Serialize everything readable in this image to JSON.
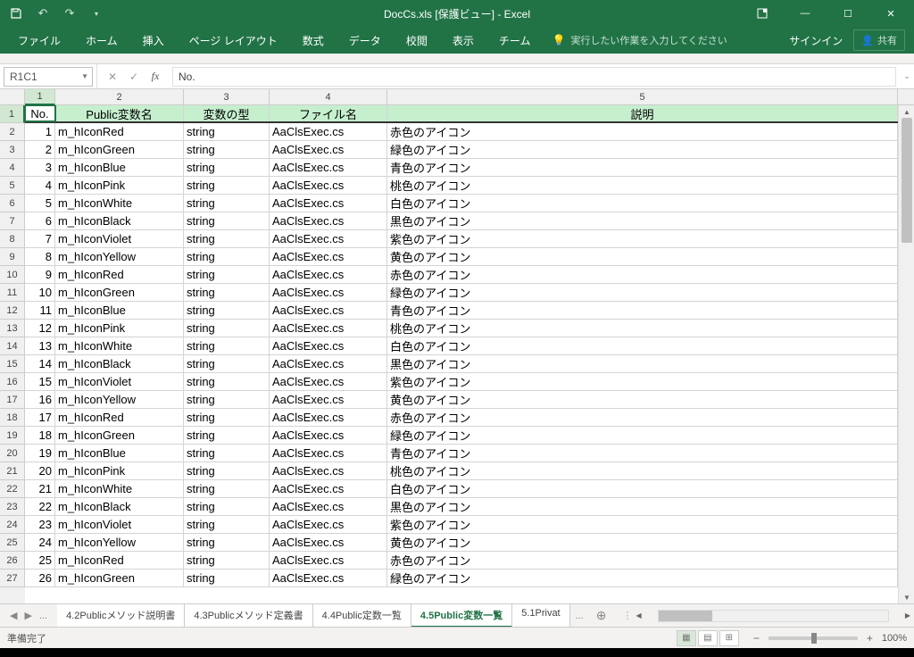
{
  "title": "DocCs.xls  [保護ビュー] - Excel",
  "qat": {
    "save": "save",
    "undo": "undo",
    "redo": "redo"
  },
  "win": {
    "ribbonopts": "⬚",
    "min": "—",
    "max": "☐",
    "close": "✕"
  },
  "tabs": [
    "ファイル",
    "ホーム",
    "挿入",
    "ページ レイアウト",
    "数式",
    "データ",
    "校閲",
    "表示",
    "チーム"
  ],
  "tellme": "実行したい作業を入力してください",
  "signin": "サインイン",
  "share": "共有",
  "nameBox": "R1C1",
  "formula": "No.",
  "colNums": [
    "1",
    "2",
    "3",
    "4",
    "5"
  ],
  "headers": {
    "c1": "No.",
    "c2": "Public変数名",
    "c3": "変数の型",
    "c4": "ファイル名",
    "c5": "説明"
  },
  "rows": [
    {
      "n": "1",
      "v": "m_hIconRed",
      "t": "string",
      "f": "AaClsExec.cs",
      "d": "赤色のアイコン"
    },
    {
      "n": "2",
      "v": "m_hIconGreen",
      "t": "string",
      "f": "AaClsExec.cs",
      "d": "緑色のアイコン"
    },
    {
      "n": "3",
      "v": "m_hIconBlue",
      "t": "string",
      "f": "AaClsExec.cs",
      "d": "青色のアイコン"
    },
    {
      "n": "4",
      "v": "m_hIconPink",
      "t": "string",
      "f": "AaClsExec.cs",
      "d": "桃色のアイコン"
    },
    {
      "n": "5",
      "v": "m_hIconWhite",
      "t": "string",
      "f": "AaClsExec.cs",
      "d": "白色のアイコン"
    },
    {
      "n": "6",
      "v": "m_hIconBlack",
      "t": "string",
      "f": "AaClsExec.cs",
      "d": "黒色のアイコン"
    },
    {
      "n": "7",
      "v": "m_hIconViolet",
      "t": "string",
      "f": "AaClsExec.cs",
      "d": "紫色のアイコン"
    },
    {
      "n": "8",
      "v": "m_hIconYellow",
      "t": "string",
      "f": "AaClsExec.cs",
      "d": "黄色のアイコン"
    },
    {
      "n": "9",
      "v": "m_hIconRed",
      "t": "string",
      "f": "AaClsExec.cs",
      "d": "赤色のアイコン"
    },
    {
      "n": "10",
      "v": "m_hIconGreen",
      "t": "string",
      "f": "AaClsExec.cs",
      "d": "緑色のアイコン"
    },
    {
      "n": "11",
      "v": "m_hIconBlue",
      "t": "string",
      "f": "AaClsExec.cs",
      "d": "青色のアイコン"
    },
    {
      "n": "12",
      "v": "m_hIconPink",
      "t": "string",
      "f": "AaClsExec.cs",
      "d": "桃色のアイコン"
    },
    {
      "n": "13",
      "v": "m_hIconWhite",
      "t": "string",
      "f": "AaClsExec.cs",
      "d": "白色のアイコン"
    },
    {
      "n": "14",
      "v": "m_hIconBlack",
      "t": "string",
      "f": "AaClsExec.cs",
      "d": "黒色のアイコン"
    },
    {
      "n": "15",
      "v": "m_hIconViolet",
      "t": "string",
      "f": "AaClsExec.cs",
      "d": "紫色のアイコン"
    },
    {
      "n": "16",
      "v": "m_hIconYellow",
      "t": "string",
      "f": "AaClsExec.cs",
      "d": "黄色のアイコン"
    },
    {
      "n": "17",
      "v": "m_hIconRed",
      "t": "string",
      "f": "AaClsExec.cs",
      "d": "赤色のアイコン"
    },
    {
      "n": "18",
      "v": "m_hIconGreen",
      "t": "string",
      "f": "AaClsExec.cs",
      "d": "緑色のアイコン"
    },
    {
      "n": "19",
      "v": "m_hIconBlue",
      "t": "string",
      "f": "AaClsExec.cs",
      "d": "青色のアイコン"
    },
    {
      "n": "20",
      "v": "m_hIconPink",
      "t": "string",
      "f": "AaClsExec.cs",
      "d": "桃色のアイコン"
    },
    {
      "n": "21",
      "v": "m_hIconWhite",
      "t": "string",
      "f": "AaClsExec.cs",
      "d": "白色のアイコン"
    },
    {
      "n": "22",
      "v": "m_hIconBlack",
      "t": "string",
      "f": "AaClsExec.cs",
      "d": "黒色のアイコン"
    },
    {
      "n": "23",
      "v": "m_hIconViolet",
      "t": "string",
      "f": "AaClsExec.cs",
      "d": "紫色のアイコン"
    },
    {
      "n": "24",
      "v": "m_hIconYellow",
      "t": "string",
      "f": "AaClsExec.cs",
      "d": "黄色のアイコン"
    },
    {
      "n": "25",
      "v": "m_hIconRed",
      "t": "string",
      "f": "AaClsExec.cs",
      "d": "赤色のアイコン"
    },
    {
      "n": "26",
      "v": "m_hIconGreen",
      "t": "string",
      "f": "AaClsExec.cs",
      "d": "緑色のアイコン"
    }
  ],
  "sheets": {
    "ellipsis": "...",
    "list": [
      "4.2Publicメソッド説明書",
      "4.3Publicメソッド定義書",
      "4.4Public定数一覧",
      "4.5Public変数一覧",
      "5.1Privat"
    ],
    "trailingEllipsis": "...",
    "activeIndex": 3
  },
  "status": "準備完了",
  "zoom": "100%"
}
